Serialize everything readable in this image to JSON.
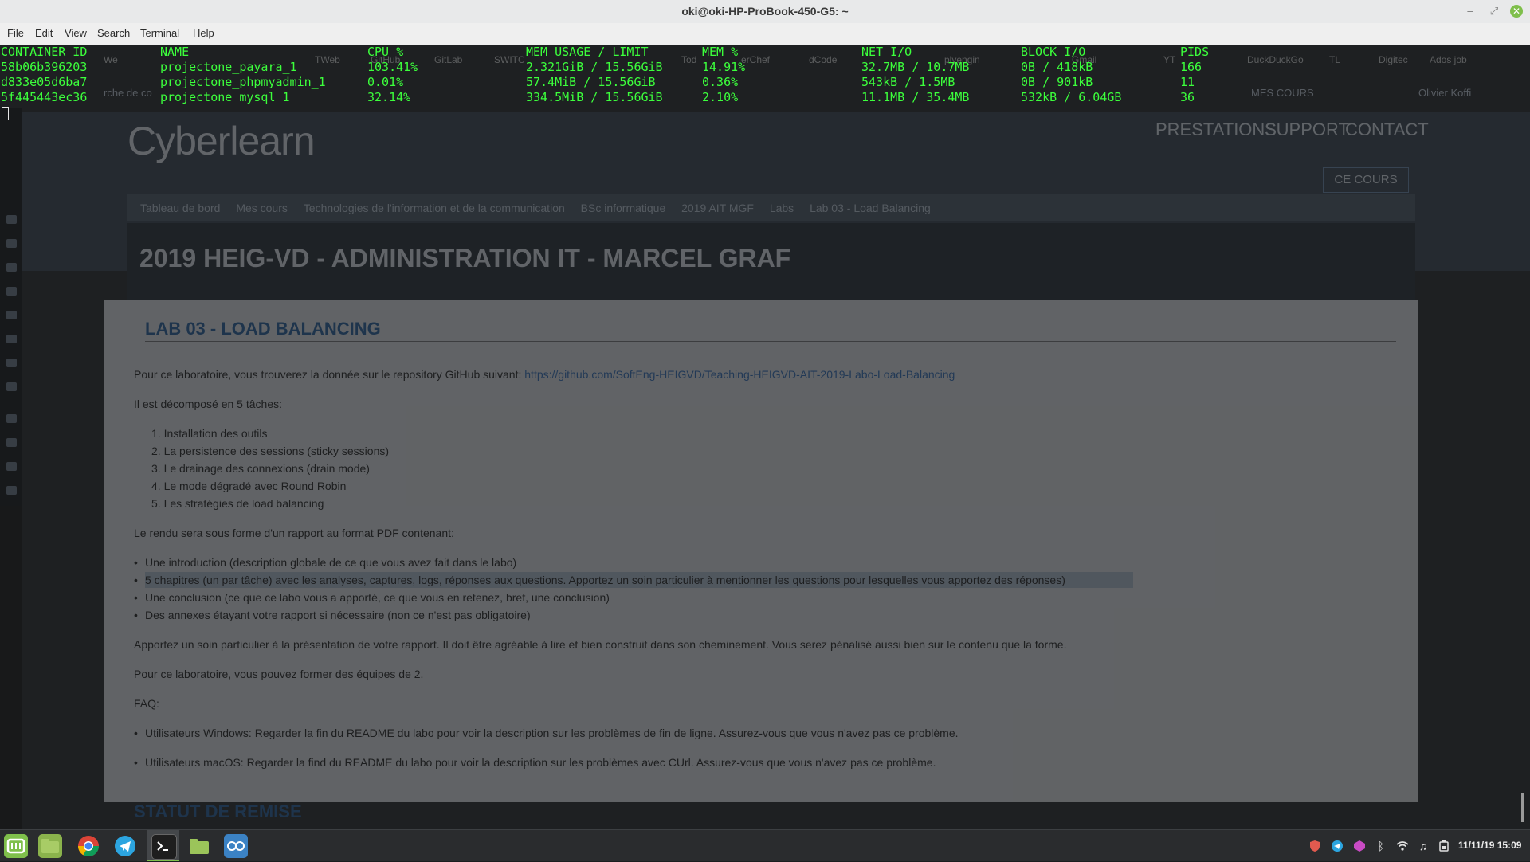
{
  "window": {
    "title": "oki@oki-HP-ProBook-450-G5: ~",
    "min_icon": "minimize-icon",
    "max_icon": "maximize-icon",
    "close_icon": "close-icon"
  },
  "menu": [
    "File",
    "Edit",
    "View",
    "Search",
    "Terminal",
    "Help"
  ],
  "docker_stats": {
    "headers": [
      "CONTAINER ID",
      "NAME",
      "CPU %",
      "MEM USAGE / LIMIT",
      "MEM %",
      "NET I/O",
      "BLOCK I/O",
      "PIDS"
    ],
    "rows": [
      [
        "58b06b396203",
        "projectone_payara_1",
        "103.41%",
        "2.321GiB / 15.56GiB",
        "14.91%",
        "32.7MB / 10.7MB",
        "0B / 418kB",
        "166"
      ],
      [
        "d833e05d6ba7",
        "projectone_phpmyadmin_1",
        "0.01%",
        "57.4MiB / 15.56GiB",
        "0.36%",
        "543kB / 1.5MB",
        "0B / 901kB",
        "11"
      ],
      [
        "5f445443ec36",
        "projectone_mysql_1",
        "32.14%",
        "334.5MiB / 15.56GiB",
        "2.10%",
        "11.1MB / 35.4MB",
        "532kB / 6.04GB",
        "36"
      ]
    ],
    "text_color": "#3cff3c"
  },
  "background_page": {
    "bookmarks": [
      "We",
      "TWeb",
      "GitHub",
      "GitLab",
      "SWITC",
      "Tod",
      "erChef",
      "dCode",
      "plyengin",
      "Gmail",
      "YT",
      "DuckDuckGo",
      "TL",
      "Digitec",
      "Ados job"
    ],
    "search_hint": "rche de co",
    "user_menu": [
      "MES COURS",
      "Olivier Koffi"
    ],
    "logo": "Cyberlearn",
    "nav": [
      "PRESTATIONS",
      "SUPPORT",
      "CONTACT"
    ],
    "ce_cours": "CE COURS",
    "breadcrumb": [
      "Tableau de bord",
      "Mes cours",
      "Technologies de l'information et de la communication",
      "BSc informatique",
      "2019 AIT MGF",
      "Labs",
      "Lab 03 - Load Balancing"
    ],
    "course_title": "2019 HEIG-VD - ADMINISTRATION IT - MARCEL GRAF",
    "section_title": "LAB 03 - LOAD BALANCING",
    "intro": "Pour ce laboratoire, vous trouverez la donnée sur le repository GitHub suivant:",
    "repo_link": "https://github.com/SoftEng-HEIGVD/Teaching-HEIGVD-AIT-2019-Labo-Load-Balancing",
    "tasks_intro": "Il est décomposé en 5 tâches:",
    "tasks": [
      "1. Installation des outils",
      "2. La persistence des sessions (sticky sessions)",
      "3. Le drainage des connexions (drain mode)",
      "4. Le mode dégradé avec Round Robin",
      "5. Les stratégies de load balancing"
    ],
    "report_intro": "Le rendu sera sous forme d'un rapport au format PDF contenant:",
    "report_items": [
      "Une introduction (description globale de ce que vous avez fait dans le labo)",
      "5 chapitres (un par tâche) avec les analyses, captures, logs, réponses aux questions. Apportez un soin particulier à mentionner les questions pour lesquelles vous apportez des réponses)",
      "Une conclusion (ce que ce labo vous a apporté, ce que vous en retenez, bref, une conclusion)",
      "Des annexes étayant votre rapport si nécessaire (non ce n'est pas obligatoire)"
    ],
    "presentation": "Apportez un soin particulier à la présentation de votre rapport. Il doit être agréable à lire et bien construit dans son cheminement. Vous serez pénalisé aussi bien sur le contenu que la forme.",
    "teams": "Pour ce laboratoire, vous pouvez former des équipes de 2.",
    "faq": "FAQ:",
    "faq_items": [
      "Utilisateurs Windows: Regarder la fin du README du labo pour voir la description sur les problèmes de fin de ligne. Assurez-vous que vous n'avez pas ce problème.",
      "Utilisateurs macOS: Regarder la find du README du labo pour voir la description sur les problèmes avec CUrl. Assurez-vous que vous n'avez pas ce problème."
    ],
    "statut": "STATUT DE REMISE"
  },
  "taskbar": {
    "apps": [
      "mint-menu-icon",
      "files-icon",
      "chrome-icon",
      "telegram-icon",
      "terminal-icon",
      "folder-icon",
      "visual-icon"
    ],
    "tray": [
      "shield-icon",
      "telegram-tray-icon",
      "app-tray-icon",
      "bluetooth-icon",
      "wifi-icon",
      "music-icon",
      "battery-icon"
    ],
    "clock": "11/11/19 15:09"
  }
}
